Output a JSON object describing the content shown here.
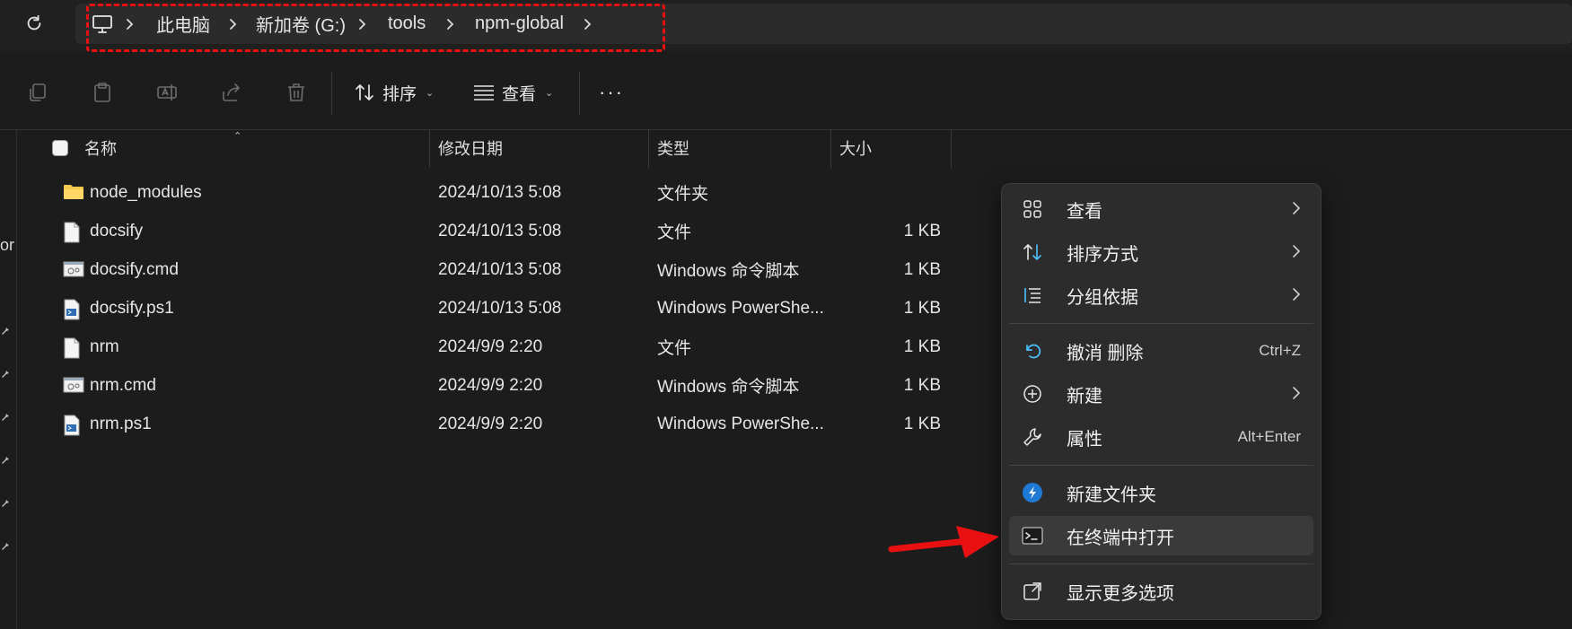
{
  "address_bar": {
    "crumbs": [
      "此电脑",
      "新加卷 (G:)",
      "tools",
      "npm-global"
    ]
  },
  "toolbar": {
    "sort_label": "排序",
    "view_label": "查看",
    "more_label": "···"
  },
  "columns": {
    "name": "名称",
    "date": "修改日期",
    "type": "类型",
    "size": "大小"
  },
  "files": [
    {
      "name": "node_modules",
      "date": "2024/10/13 5:08",
      "type": "文件夹",
      "size": "",
      "icon": "folder-icon"
    },
    {
      "name": "docsify",
      "date": "2024/10/13 5:08",
      "type": "文件",
      "size": "1 KB",
      "icon": "file-icon"
    },
    {
      "name": "docsify.cmd",
      "date": "2024/10/13 5:08",
      "type": "Windows 命令脚本",
      "size": "1 KB",
      "icon": "cmd-file-icon"
    },
    {
      "name": "docsify.ps1",
      "date": "2024/10/13 5:08",
      "type": "Windows PowerShe...",
      "size": "1 KB",
      "icon": "powershell-file-icon"
    },
    {
      "name": "nrm",
      "date": "2024/9/9 2:20",
      "type": "文件",
      "size": "1 KB",
      "icon": "file-icon"
    },
    {
      "name": "nrm.cmd",
      "date": "2024/9/9 2:20",
      "type": "Windows 命令脚本",
      "size": "1 KB",
      "icon": "cmd-file-icon"
    },
    {
      "name": "nrm.ps1",
      "date": "2024/9/9 2:20",
      "type": "Windows PowerShe...",
      "size": "1 KB",
      "icon": "powershell-file-icon"
    }
  ],
  "context_menu": {
    "view": "查看",
    "sort_by": "排序方式",
    "group_by": "分组依据",
    "undo_delete": "撤消 删除",
    "undo_shortcut": "Ctrl+Z",
    "new": "新建",
    "properties": "属性",
    "properties_shortcut": "Alt+Enter",
    "new_folder": "新建文件夹",
    "open_in_terminal": "在终端中打开",
    "show_more_options": "显示更多选项"
  },
  "left_strip_text": "or",
  "colors": {
    "background": "#1c1c1c",
    "menu_bg": "#2c2c2c",
    "accent_blue": "#4cc2ff",
    "annotation_red": "#e81010",
    "folder_yellow": "#f2c94c"
  }
}
